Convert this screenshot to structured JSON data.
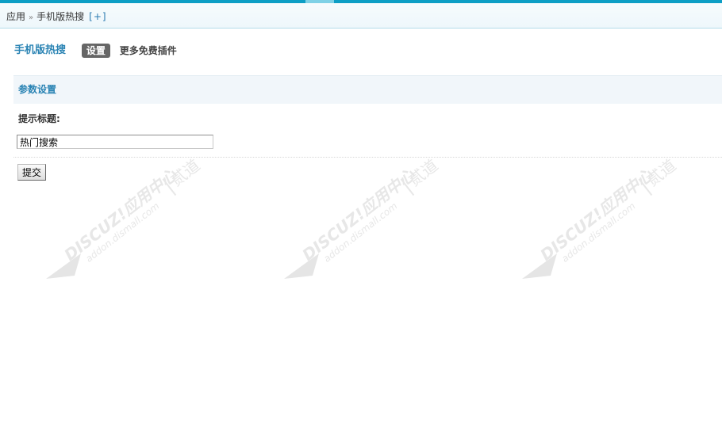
{
  "breadcrumb": {
    "root": "应用",
    "separator": "»",
    "current": "手机版热搜",
    "add": "[+]"
  },
  "plugin": {
    "title": "手机版热搜",
    "tabs": {
      "settings": "设置",
      "more": "更多免费插件"
    }
  },
  "section": {
    "title": "参数设置"
  },
  "form": {
    "field_label": "提示标题:",
    "field_value": "热门搜索",
    "submit_label": "提交"
  },
  "watermark": {
    "line1": "DISCUZ!应用中心",
    "line2": "addon.dismall.com",
    "brand": "贰道"
  },
  "colors": {
    "accent": "#2b84b4",
    "top_stripe": "#0d9ec5",
    "tab_active_bg": "#666666",
    "section_bg": "#f1f6fa"
  }
}
